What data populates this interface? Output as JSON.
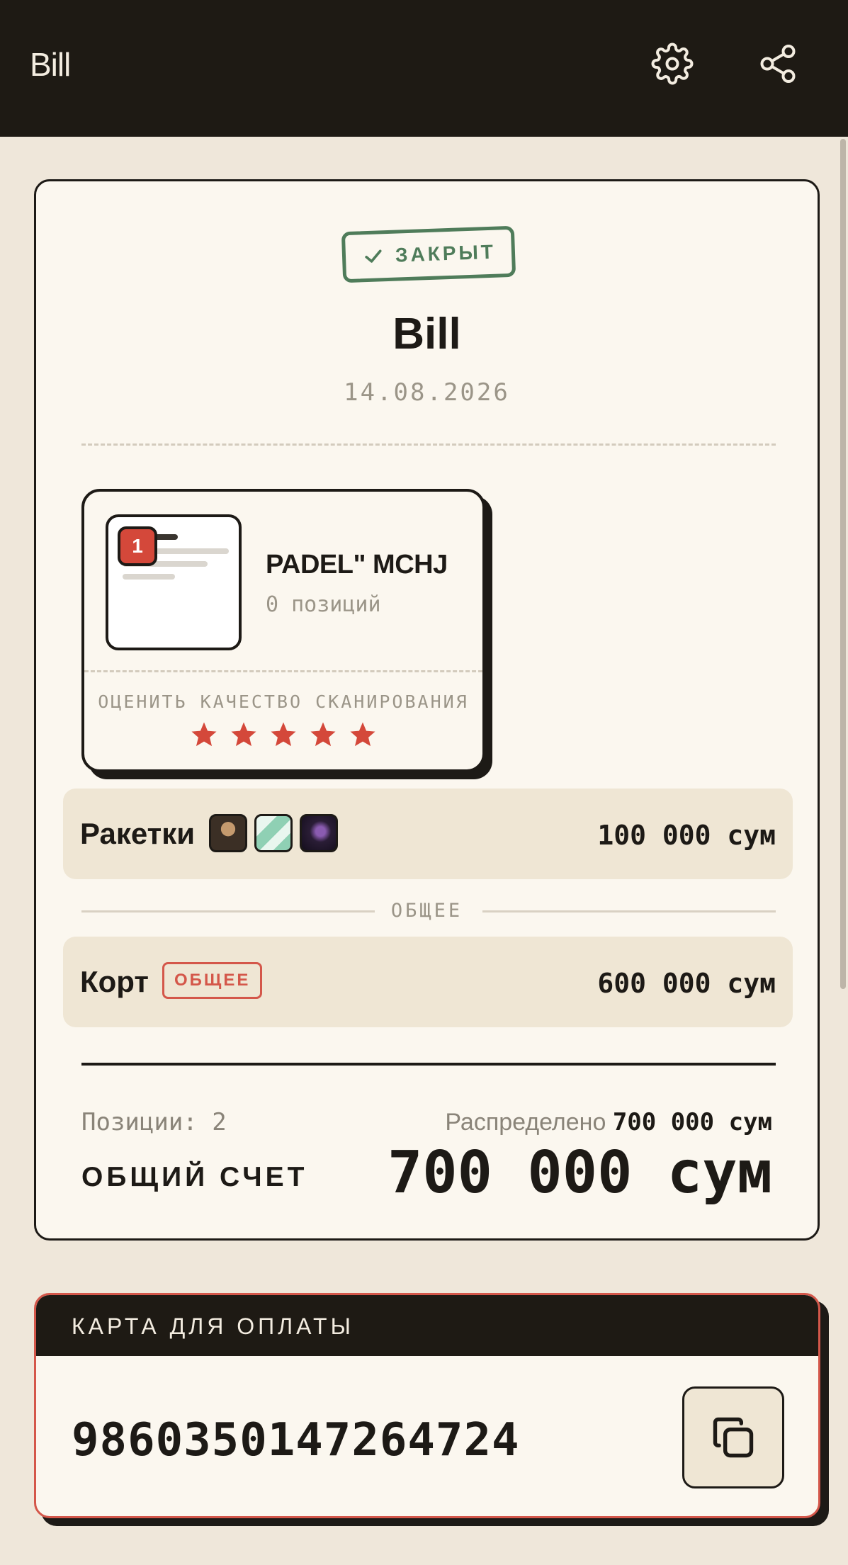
{
  "app_bar": {
    "title": "Bill",
    "settings_icon": "gear-icon",
    "share_icon": "share-icon"
  },
  "receipt": {
    "status": "ЗАКРЫТ",
    "title": "Bill",
    "date": "14.08.2026",
    "scan": {
      "count_badge": "1",
      "merchant": "PADEL\" MCHJ",
      "positions": "0 позиций",
      "rate_label": "ОЦЕНИТЬ КАЧЕСТВО СКАНИРОВАНИЯ",
      "stars": 5
    },
    "items": [
      {
        "name": "Ракетки",
        "price": "100 000 сум",
        "participants": 3
      },
      {
        "name": "Корт",
        "tag": "ОБЩЕЕ",
        "price": "600 000 сум"
      }
    ],
    "shared_section_label": "ОБЩЕЕ",
    "summary": {
      "positions_label": "Позиции: 2",
      "distributed_label": "Распределено",
      "distributed_value": "700 000 сум",
      "total_label": "ОБЩИЙ СЧЕТ",
      "total_value": "700 000 сум"
    }
  },
  "payment": {
    "title": "КАРТА ДЛЯ ОПЛАТЫ",
    "card_number": "9860350147264724",
    "copy_icon": "copy-icon"
  },
  "colors": {
    "background": "#efe7da",
    "header": "#1e1a14",
    "closed_green": "#4f7c5a",
    "accent_red": "#d4483a"
  }
}
